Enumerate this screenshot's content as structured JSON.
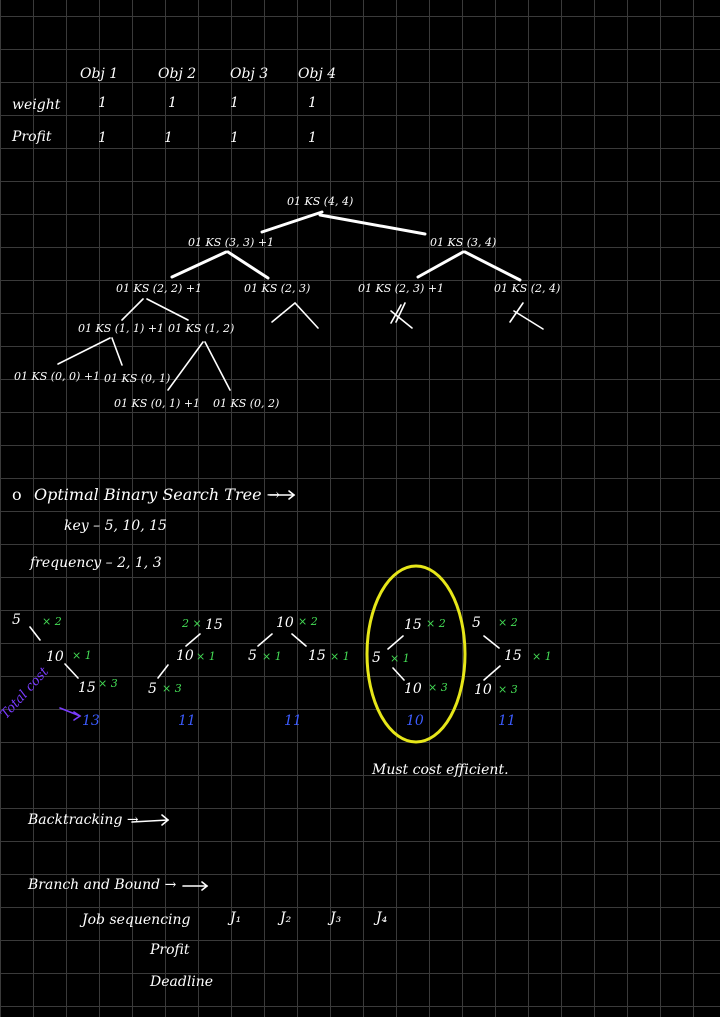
{
  "table": {
    "headers": [
      "Obj 1",
      "Obj 2",
      "Obj 3",
      "Obj 4"
    ],
    "rows": [
      {
        "label": "weight",
        "values": [
          "1",
          "1",
          "1",
          "1"
        ]
      },
      {
        "label": "Profit",
        "values": [
          "1",
          "1",
          "1",
          "1"
        ]
      }
    ]
  },
  "tree": {
    "root": "01 KS (4, 4)",
    "l1_left": "01 KS (3, 3) +1",
    "l1_right": "01 KS (3, 4)",
    "l2": [
      "01 KS (2, 2) +1",
      "01 KS (2, 3)",
      "01 KS (2, 3) +1",
      "01 KS (2, 4)"
    ],
    "l3": [
      "01 KS (1, 1) +1",
      "01 KS (1, 2)"
    ],
    "l4": [
      "01 KS (0, 0) +1",
      "01 KS (0, 1)",
      "01 KS (0, 1) +1",
      "01 KS (0, 2)"
    ]
  },
  "obst": {
    "bullet": "o",
    "title": "Optimal Binary Search Tree →",
    "keys_line": "key – 5, 10, 15",
    "freq_line": "frequency – 2, 1, 3",
    "trees": [
      {
        "nodes": [
          "5",
          "10",
          "15"
        ],
        "mults": [
          "× 2",
          "× 1",
          "× 3"
        ],
        "cost": "13"
      },
      {
        "nodes": [
          "15",
          "10",
          "5"
        ],
        "mults": [
          "2 ×",
          "× 1",
          "× 3"
        ],
        "cost": "11"
      },
      {
        "nodes": [
          "10",
          "5",
          "15"
        ],
        "mults": [
          "× 2",
          "× 1",
          "× 1"
        ],
        "cost": "11"
      },
      {
        "nodes": [
          "15",
          "5",
          "10"
        ],
        "mults": [
          "× 2",
          "× 1",
          "× 3"
        ],
        "cost": "10"
      },
      {
        "nodes": [
          "5",
          "15",
          "10"
        ],
        "mults": [
          "× 2",
          "× 1",
          "× 3"
        ],
        "cost": "11"
      }
    ],
    "total_cost_label": "Total cost",
    "conclusion": "Must cost efficient."
  },
  "backtracking": "Backtracking →",
  "branch_bound": {
    "title": "Branch and Bound →",
    "job_label": "Job sequencing",
    "jobs": [
      "J₁",
      "J₂",
      "J₃",
      "J₄"
    ],
    "profit": "Profit",
    "deadline": "Deadline"
  },
  "colors": {
    "ink": "#ffffff",
    "multiplier": "#44dd55",
    "cost": "#3c5cff",
    "highlight": "#e6e619",
    "total_cost": "#7a3cff"
  }
}
